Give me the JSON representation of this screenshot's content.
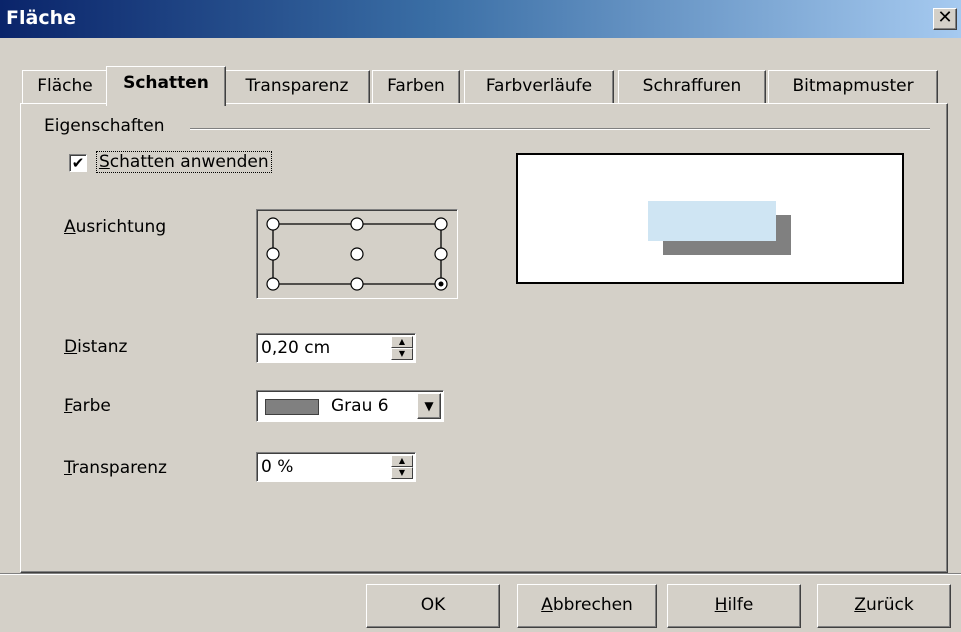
{
  "window": {
    "title": "Fläche",
    "close_glyph": "✕"
  },
  "tabs": [
    {
      "label": "Fläche"
    },
    {
      "label": "Schatten",
      "active": true
    },
    {
      "label": "Transparenz"
    },
    {
      "label": "Farben"
    },
    {
      "label": "Farbverläufe"
    },
    {
      "label": "Schraffuren"
    },
    {
      "label": "Bitmapmuster"
    }
  ],
  "properties": {
    "group_label": "Eigenschaften",
    "apply_shadow": {
      "first": "S",
      "rest": "chatten anwenden",
      "checked": true,
      "check_glyph": "✔"
    },
    "alignment": {
      "first": "A",
      "rest": "usrichtung",
      "selected": "bottom-right"
    },
    "distance": {
      "first": "D",
      "rest": "istanz",
      "value": "0,20 cm"
    },
    "color": {
      "first": "F",
      "rest": "arbe",
      "value": "Grau 6",
      "swatch": "#808080"
    },
    "transparency": {
      "first": "T",
      "rest": "ransparenz",
      "value": "0 %"
    }
  },
  "preview": {
    "box_color": "#cfe5f3",
    "shadow_color": "#808080"
  },
  "buttons": {
    "ok": {
      "first": "OK",
      "rest": ""
    },
    "cancel": {
      "first": "A",
      "rest": "bbrechen"
    },
    "help": {
      "first": "H",
      "rest": "ilfe"
    },
    "back": {
      "first": "Z",
      "rest": "urück"
    }
  }
}
